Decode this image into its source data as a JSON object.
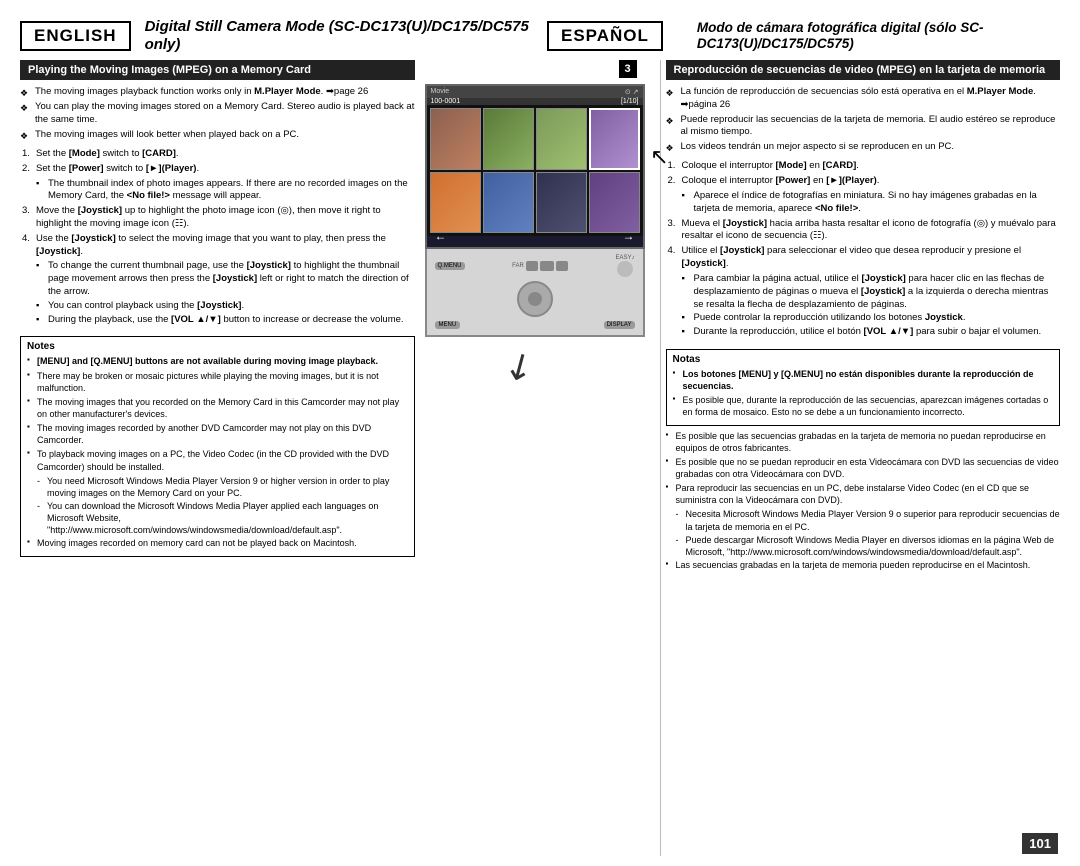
{
  "page": {
    "number": "101"
  },
  "header": {
    "lang_left": "ENGLISH",
    "lang_right": "ESPAÑOL",
    "title_left": "Digital Still Camera Mode (SC-DC173(U)/DC175/DC575 only)",
    "title_right": "Modo de cámara fotográfica digital (sólo SC-DC173(U)/DC175/DC575)"
  },
  "left": {
    "section_title": "Playing the Moving Images (MPEG) on a Memory Card",
    "bullets": [
      "The moving images playback function works only in M.Player Mode. ➡page 26",
      "You can play the moving images stored on a Memory Card. Stereo audio is played back at the same time.",
      "The moving images will look better when played back on a PC."
    ],
    "steps": [
      {
        "num": "1.",
        "text": "Set the [Mode] switch to [CARD]."
      },
      {
        "num": "2.",
        "text": "Set the [Power] switch to [►](Player).",
        "subs": [
          "The thumbnail index of photo images appears. If there are no recorded images on the Memory Card, the <No file!> message will appear."
        ]
      },
      {
        "num": "3.",
        "text": "Move the [Joystick] up to highlight the photo image icon (◎), then move it right to highlight the moving image icon (☷)."
      },
      {
        "num": "4.",
        "text": "Use the [Joystick] to select the moving image that you want to play, then press the [Joystick].",
        "subs": [
          "To change the current thumbnail page, use the [Joystick] to highlight the thumbnail page movement arrows then press the [Joystick] left or right to match the direction of the arrow.",
          "You can control playback using the [Joystick].",
          "During the playback, use the [VOL ▲/▼] button to increase or decrease the volume."
        ]
      }
    ],
    "notes_title": "Notes",
    "notes": [
      "[MENU] and [Q.MENU] buttons are not available during moving image playback.",
      "There may be broken or mosaic pictures while playing the moving images, but it is not malfunction.",
      "The moving images that you recorded on the Memory Card in this Camcorder may not play on other manufacturer's devices.",
      "The moving images recorded by another DVD Camcorder may not play on this DVD Camcorder.",
      "To playback moving images on a PC, the Video Codec (in the CD provided with the DVD Camcorder) should be installed.",
      "You need Microsoft Windows Media Player Version 9 or higher version in order to play moving images on the Memory Card on your PC.",
      "You can download the Microsoft Windows Media Player applied each languages on Microsoft Website, \"http://www.microsoft.com/windows/windowsmedia/download/default.asp\".",
      "Moving images recorded on memory card can not be played back on Macintosh."
    ],
    "note_sub_items": [
      "You need Microsoft Windows Media Player Version 9 or higher version in order to play moving images on the Memory Card on your PC.",
      "You can download the Microsoft Windows Media Player applied each languages on Microsoft Website, \"http://www.microsoft.com/windows/windowsmedia/download/default.asp\"."
    ]
  },
  "right": {
    "section_title": "Reproducción de secuencias de video (MPEG) en la tarjeta de memoria",
    "bullets": [
      "La función de reproducción de secuencias sólo está operativa en el M.Player Mode. ➡página 26",
      "Puede reproducir las secuencias de la tarjeta de memoria. El audio estéreo se reproduce al mismo tiempo.",
      "Los videos tendrán un mejor aspecto si se reproducen en un PC."
    ],
    "steps": [
      {
        "num": "1.",
        "text": "Coloque el interruptor [Mode] en [CARD]."
      },
      {
        "num": "2.",
        "text": "Coloque el interruptor [Power] en [►](Player).",
        "subs": [
          "Aparece el índice de fotografías en miniatura. Si no hay imágenes grabadas en la tarjeta de memoria, aparece <No file!>."
        ]
      },
      {
        "num": "3.",
        "text": "Mueva el [Joystick] hacia arriba hasta resaltar el icono de fotografía (◎) y muévalo para resaltar el icono de secuencia (☷)."
      },
      {
        "num": "4.",
        "text": "Utilice el [Joystick] para seleccionar el video que desea reproducir y presione el [Joystick].",
        "subs": [
          "Para cambiar la página actual, utilice el [Joystick] para hacer clic en las flechas de desplazamiento de páginas o mueva el [Joystick] a la izquierda o derecha mientras se resalta la flecha de desplazamiento de páginas.",
          "Puede controlar la reproducción utilizando los botones Joystick.",
          "Durante la reproducción, utilice el botón [VOL ▲/▼] para subir o bajar el volumen."
        ]
      }
    ],
    "notes_title": "Notas",
    "notes": [
      "Los botones [MENU] y [Q.MENU] no están disponibles durante la reproducción de secuencias.",
      "Es posible que, durante la reproducción de las secuencias, aparezcan imágenes cortadas o en forma de mosaico. Esto no se debe a un funcionamiento incorrecto.",
      "Es posible que las secuencias grabadas en la tarjeta de memoria no puedan reproducirse en equipos de otros fabricantes.",
      "Es posible que no se puedan reproducir en esta Videocámara con DVD las secuencias de video grabadas con otra Videocámara con DVD.",
      "Para reproducir las secuencias en un PC, debe instalarse Video Codec (en el CD que se suministra con la Videocámara con DVD).",
      "Necesita Microsoft Windows Media Player Version 9 o superior para reproducir secuencias de la tarjeta de memoria en el PC.",
      "Puede descargar Microsoft Windows Media Player en diversos idiomas en la página Web de Microsoft, \"http://www.microsoft.com/windows/windowsmedia/download/default.asp\".",
      "Las secuencias grabadas en la tarjeta de memoria pueden reproducirse en el Macintosh."
    ]
  },
  "screen": {
    "label": "Movie",
    "counter": "100-0001",
    "page": "[1/10]"
  }
}
